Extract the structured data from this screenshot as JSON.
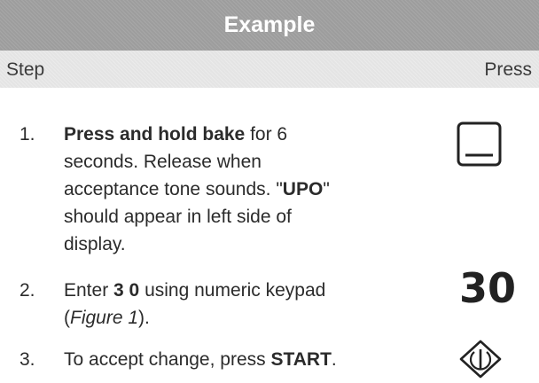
{
  "title": "Example",
  "header": {
    "step": "Step",
    "press": "Press"
  },
  "steps": [
    {
      "num": "1.",
      "parts": [
        {
          "t": "Press and hold bake",
          "b": true
        },
        {
          "t": " for 6 seconds. Release when acceptance tone sounds. \""
        },
        {
          "t": "UPO",
          "b": true
        },
        {
          "t": "\" should appear in left side of display."
        }
      ],
      "press": {
        "type": "icon",
        "icon": "bake-key-icon"
      }
    },
    {
      "num": "2.",
      "parts": [
        {
          "t": "Enter "
        },
        {
          "t": "3 0",
          "b": true
        },
        {
          "t": " using numeric keypad ("
        },
        {
          "t": "Figure 1",
          "i": true
        },
        {
          "t": ")."
        }
      ],
      "press": {
        "type": "text",
        "text": "30"
      }
    },
    {
      "num": "3.",
      "parts": [
        {
          "t": "To accept change, press "
        },
        {
          "t": "START",
          "b": true
        },
        {
          "t": "."
        }
      ],
      "press": {
        "type": "icon",
        "icon": "start-key-icon"
      }
    }
  ],
  "colors": {
    "title_bg": "#9d9d9d",
    "header_bg": "#e4e4e4",
    "text": "#2b2b2b"
  }
}
